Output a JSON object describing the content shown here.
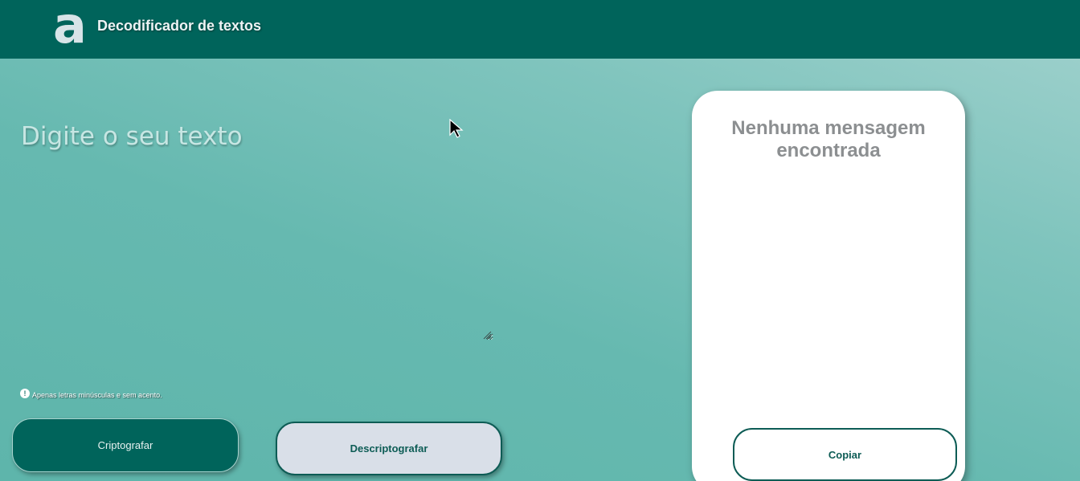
{
  "header": {
    "logo_glyph": "a",
    "title": "Decodificador de textos"
  },
  "input": {
    "placeholder": "Digite o seu texto",
    "value": ""
  },
  "hint": {
    "icon": "info-icon",
    "glyph": "!",
    "text": "Apenas letras minúsculas e sem acento."
  },
  "actions": {
    "encrypt_label": "Criptografar",
    "decrypt_label": "Descriptografar"
  },
  "output": {
    "empty_message": "Nenhuma mensagem encontrada",
    "copy_label": "Copiar"
  },
  "colors": {
    "primary": "#00645b",
    "secondary": "#d9dfe8",
    "background": "#66b9b0",
    "card": "#ffffff",
    "muted_text": "#8c8f91"
  }
}
